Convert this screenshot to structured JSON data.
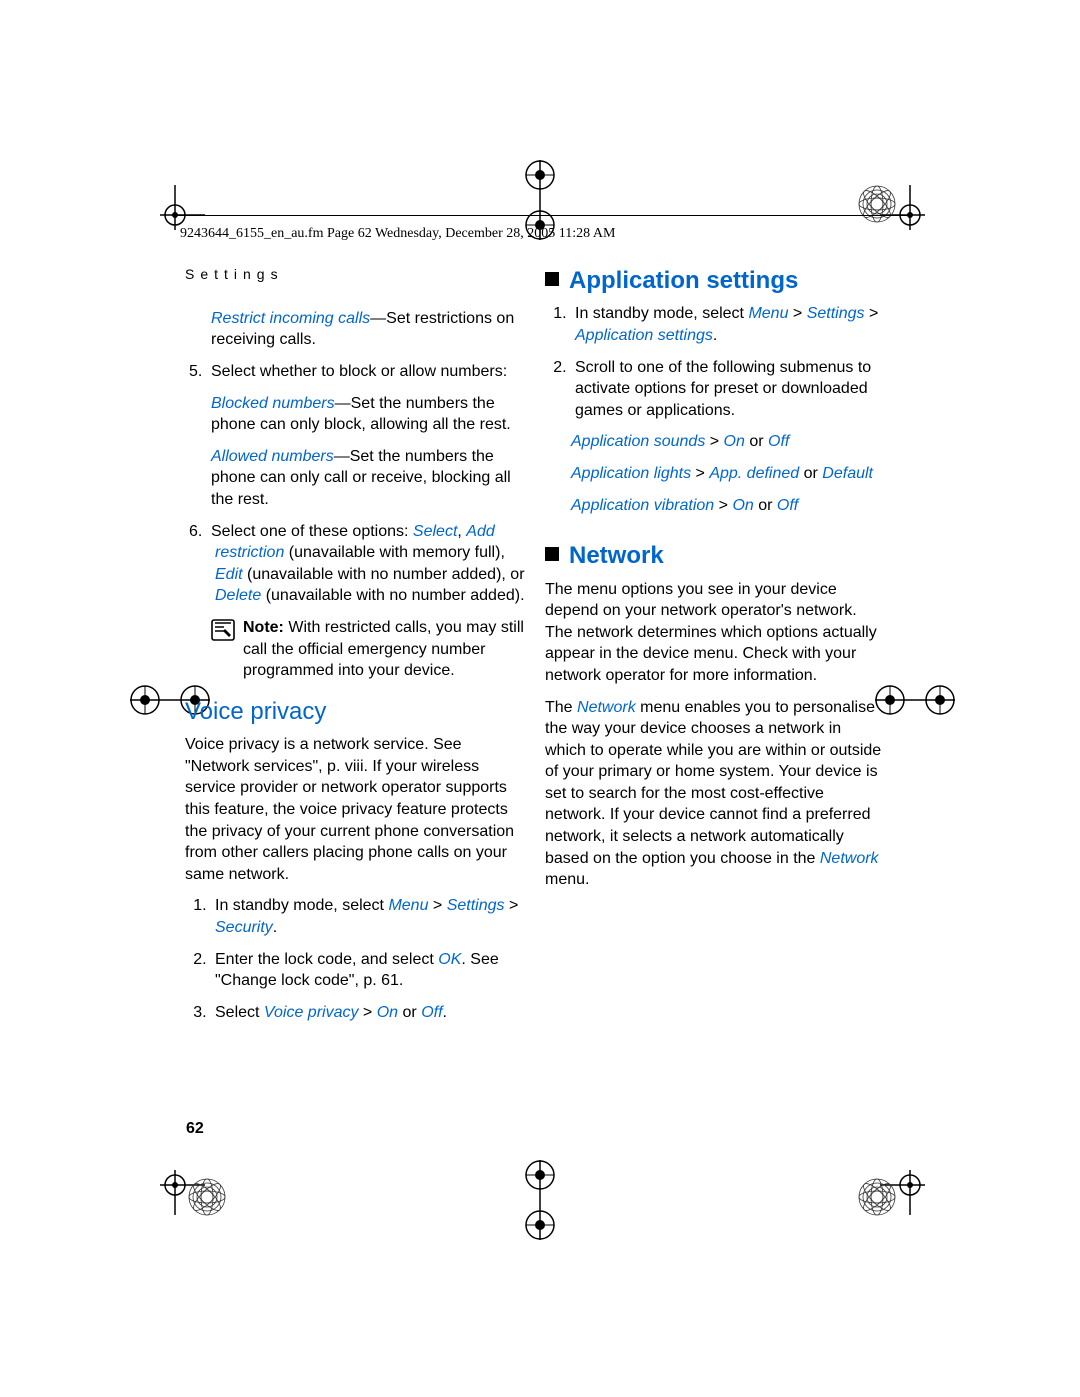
{
  "header": "9243644_6155_en_au.fm  Page 62  Wednesday, December 28, 2005  11:28 AM",
  "section_label": "Settings",
  "page_number": "62",
  "left": {
    "restrict_em": "Restrict incoming calls",
    "restrict_rest": "—Set restrictions on receiving calls.",
    "li5": "Select whether to block or allow numbers:",
    "blocked_em": "Blocked numbers",
    "blocked_rest": "—Set the numbers the phone can only block, allowing all the rest.",
    "allowed_em": "Allowed numbers",
    "allowed_rest": "—Set the numbers the phone can only call or receive, blocking all the rest.",
    "li6_a": "Select one of these options: ",
    "li6_select": "Select",
    "li6_b": ", ",
    "li6_add": "Add restriction",
    "li6_c": " (unavailable with memory full), ",
    "li6_edit": "Edit",
    "li6_d": " (unavailable with no number added), or ",
    "li6_delete": "Delete",
    "li6_e": " (unavailable with no number added).",
    "note_label": "Note:",
    "note_body": " With restricted calls, you may still call the official emergency number programmed into your device.",
    "voice_title": "Voice privacy",
    "voice_body": "Voice privacy is a network service. See \"Network services\", p. viii. If your wireless service provider or network operator supports this feature, the voice privacy feature protects the privacy of your current phone conversation from other callers placing phone calls on your same network.",
    "vp_li1_a": "In standby mode, select ",
    "vp_li1_menu": "Menu",
    "vp_li1_b": " > ",
    "vp_li1_settings": "Settings",
    "vp_li1_c": " > ",
    "vp_li1_security": "Security",
    "vp_li1_d": ".",
    "vp_li2_a": "Enter the lock code, and select ",
    "vp_li2_ok": "OK",
    "vp_li2_b": ". See \"Change lock code\", p. 61.",
    "vp_li3_a": "Select ",
    "vp_li3_vp": "Voice privacy",
    "vp_li3_b": " > ",
    "vp_li3_on": "On",
    "vp_li3_c": " or ",
    "vp_li3_off": "Off",
    "vp_li3_d": "."
  },
  "right": {
    "app_title": "Application settings",
    "app_li1_a": "In standby mode, select ",
    "app_li1_menu": "Menu",
    "app_li1_b": " > ",
    "app_li1_settings": "Settings",
    "app_li1_c": " > ",
    "app_li1_as": "Application settings",
    "app_li1_d": ".",
    "app_li2": "Scroll to one of the following submenus to activate options for preset or downloaded games or applications.",
    "as_sounds_a": "Application sounds",
    "as_sounds_b": " > ",
    "as_sounds_on": "On",
    "as_sounds_c": " or ",
    "as_sounds_off": "Off",
    "as_lights_a": "Application lights",
    "as_lights_b": " > ",
    "as_lights_def": "App. defined",
    "as_lights_c": " or ",
    "as_lights_default": "Default",
    "as_vib_a": "Application vibration",
    "as_vib_b": " > ",
    "as_vib_on": "On",
    "as_vib_c": " or ",
    "as_vib_off": "Off",
    "net_title": "Network",
    "net_p1": "The menu options you see in your device depend on your network operator's network. The network determines which options actually appear in the device menu. Check with your network operator for more information.",
    "net_p2_a": "The ",
    "net_p2_net1": "Network",
    "net_p2_b": " menu enables you to personalise the way your device chooses a network in which to operate while you are within or outside of your primary or home system. Your device is set to search for the most cost-effective network. If your device cannot find a preferred network, it selects a network automatically based on the option you choose in the ",
    "net_p2_net2": "Network",
    "net_p2_c": " menu."
  }
}
